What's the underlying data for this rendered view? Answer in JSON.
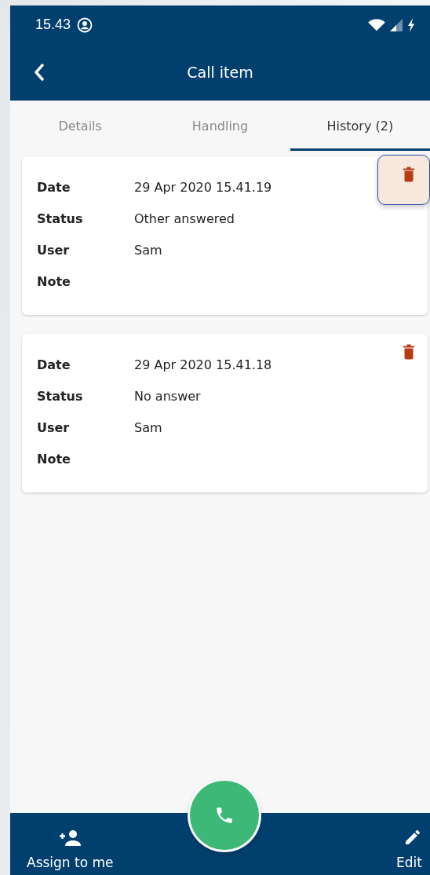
{
  "status_bar": {
    "time": "15.43"
  },
  "app_bar": {
    "title": "Call item"
  },
  "tabs": [
    {
      "label": "Details",
      "selected": false
    },
    {
      "label": "Handling",
      "selected": false
    },
    {
      "label": "History (2)",
      "selected": true
    }
  ],
  "history": [
    {
      "delete_focused": true,
      "fields": [
        {
          "label": "Date",
          "value": "29 Apr 2020 15.41.19"
        },
        {
          "label": "Status",
          "value": "Other answered"
        },
        {
          "label": "User",
          "value": "Sam"
        },
        {
          "label": "Note"
        }
      ]
    },
    {
      "delete_focused": false,
      "fields": [
        {
          "label": "Date",
          "value": "29 Apr 2020 15.41.18"
        },
        {
          "label": "Status",
          "value": "No answer"
        },
        {
          "label": "User",
          "value": "Sam"
        },
        {
          "label": "Note"
        }
      ]
    }
  ],
  "bottom_bar": {
    "left_action": "Assign to me",
    "right_action": "Edit"
  }
}
